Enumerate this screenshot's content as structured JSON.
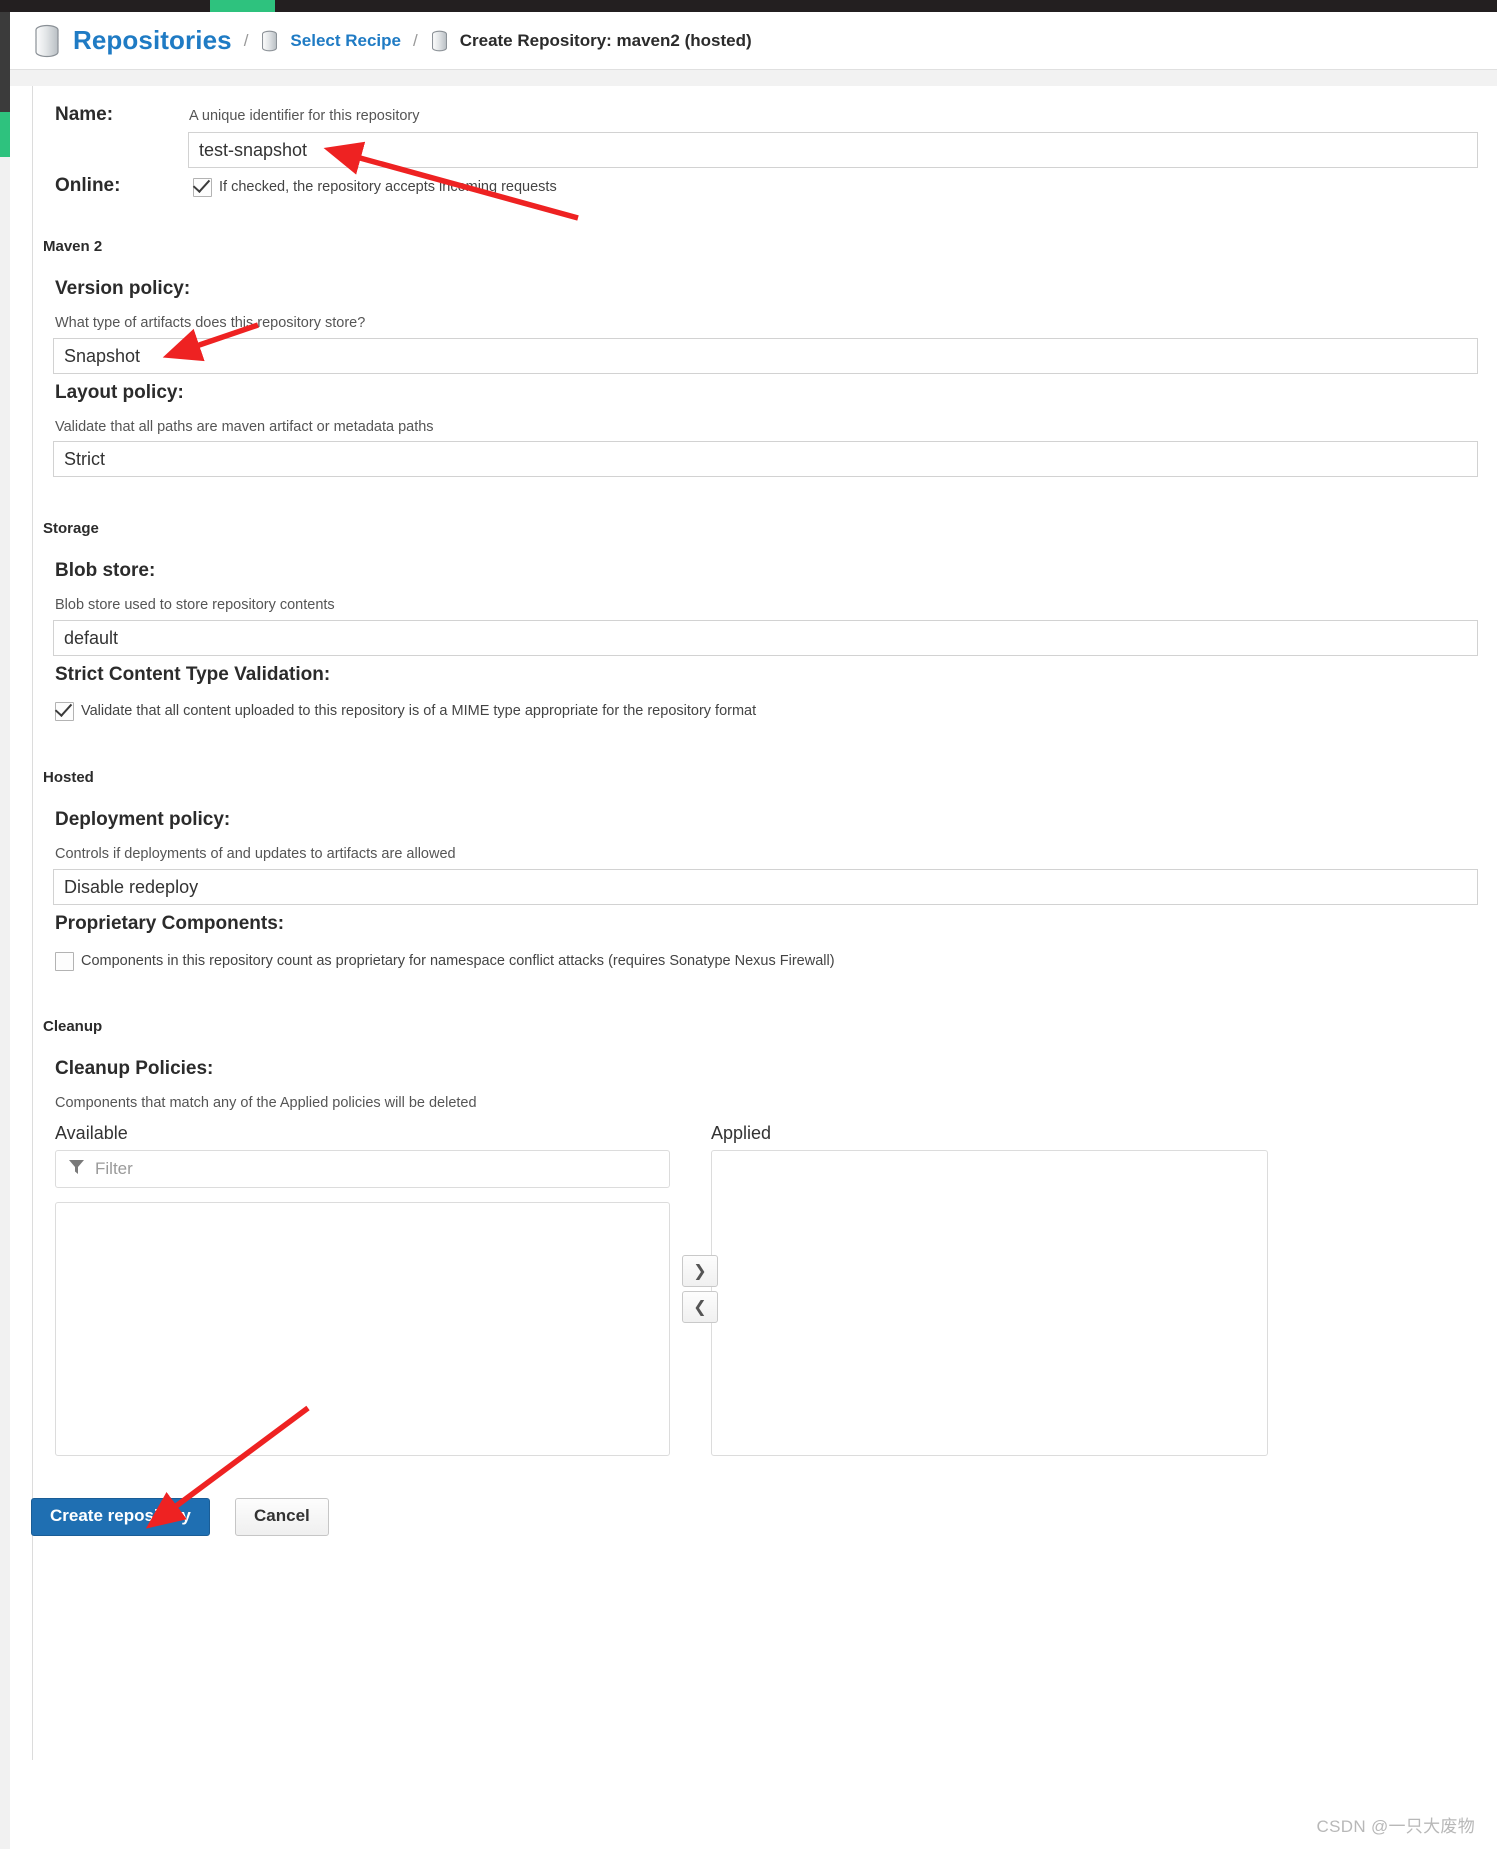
{
  "breadcrumb": {
    "root": "Repositories",
    "separator": "/",
    "middle": "Select Recipe",
    "current": "Create Repository: maven2 (hosted)",
    "root_icon": "database-icon",
    "middle_icon": "database-icon",
    "current_icon": "database-icon",
    "link_color": "#1f7bc4"
  },
  "form": {
    "name": {
      "label": "Name:",
      "hint": "A unique identifier for this repository",
      "value": "test-snapshot",
      "placeholder": ""
    },
    "online": {
      "label": "Online:",
      "checkbox_label": "If checked, the repository accepts incoming requests",
      "checked": true
    },
    "maven2": {
      "group": "Maven 2",
      "version_policy": {
        "label": "Version policy:",
        "hint": "What type of artifacts does this repository store?",
        "value": "Snapshot"
      },
      "layout_policy": {
        "label": "Layout policy:",
        "hint": "Validate that all paths are maven artifact or metadata paths",
        "value": "Strict"
      }
    },
    "storage": {
      "group": "Storage",
      "blob_store": {
        "label": "Blob store:",
        "hint": "Blob store used to store repository contents",
        "value": "default"
      },
      "strict_content": {
        "label": "Strict Content Type Validation:",
        "checkbox_label": "Validate that all content uploaded to this repository is of a MIME type appropriate for the repository format",
        "checked": true
      }
    },
    "hosted": {
      "group": "Hosted",
      "deployment_policy": {
        "label": "Deployment policy:",
        "hint": "Controls if deployments of and updates to artifacts are allowed",
        "value": "Disable redeploy"
      },
      "proprietary_components": {
        "label": "Proprietary Components:",
        "checkbox_label": "Components in this repository count as proprietary for namespace conflict attacks (requires Sonatype Nexus Firewall)",
        "checked": false
      }
    },
    "cleanup": {
      "group": "Cleanup",
      "label": "Cleanup Policies:",
      "hint": "Components that match any of the Applied policies will be deleted",
      "available_header": "Available",
      "applied_header": "Applied",
      "filter_placeholder": "Filter",
      "filter_value": "",
      "filter_icon": "funnel-icon",
      "move_right_icon": "chevron-right-icon",
      "move_left_icon": "chevron-left-icon",
      "available_items": [],
      "applied_items": []
    }
  },
  "footer": {
    "create_label": "Create repository",
    "cancel_label": "Cancel",
    "create_color": "#1f6fb2"
  },
  "watermark": {
    "text": "CSDN @一只大废物"
  }
}
